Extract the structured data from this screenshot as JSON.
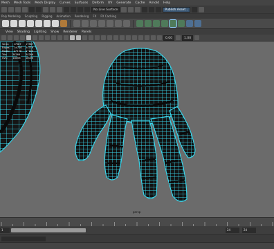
{
  "menubar": {
    "items": [
      "Mesh",
      "Mesh Tools",
      "Mesh Display",
      "Curves",
      "Surfaces",
      "Deform",
      "UV",
      "Generate",
      "Cache",
      "Arnold",
      "Help"
    ]
  },
  "statusline": {
    "live_surface": "No Live Surface",
    "workspace": "Publish Asset..."
  },
  "shelf": {
    "tabs": [
      "Poly Modeling",
      "Sculpting",
      "Rigging",
      "Animation",
      "Rendering",
      "FX",
      "FX Caching"
    ]
  },
  "panel": {
    "menus": [
      "View",
      "Shading",
      "Lighting",
      "Show",
      "Renderer",
      "Panels"
    ],
    "near_clip": "0.00",
    "far_clip": "1.00"
  },
  "hud": {
    "rows": [
      {
        "label": "Verts:",
        "a": "17587",
        "b": "17587"
      },
      {
        "label": "Edges:",
        "a": "34716",
        "b": "34716"
      },
      {
        "label": "Faces:",
        "a": "17150",
        "b": "17150"
      },
      {
        "label": "Tris:",
        "a": "34266",
        "b": "34266"
      },
      {
        "label": "UVs:",
        "a": "18006",
        "b": "18006"
      }
    ]
  },
  "viewport": {
    "camera_label": "persp",
    "background": "#6b6b6b",
    "wire_color": "#38d3e8",
    "mesh_color": "#111111"
  },
  "timeline": {
    "range_start": "1",
    "range_end": "24",
    "anim_end": "24"
  }
}
